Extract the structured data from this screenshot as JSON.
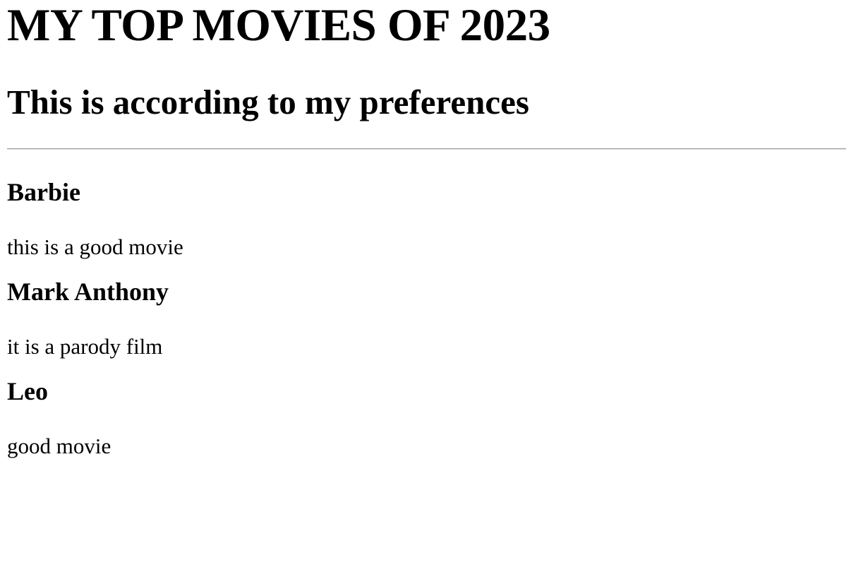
{
  "page": {
    "title": "MY TOP MOVIES OF 2023",
    "subtitle": "This is according to my preferences"
  },
  "movies": [
    {
      "title": "Barbie",
      "description": "this is a good movie"
    },
    {
      "title": "Mark Anthony",
      "description": "it is a parody film"
    },
    {
      "title": "Leo",
      "description": "good movie"
    }
  ]
}
